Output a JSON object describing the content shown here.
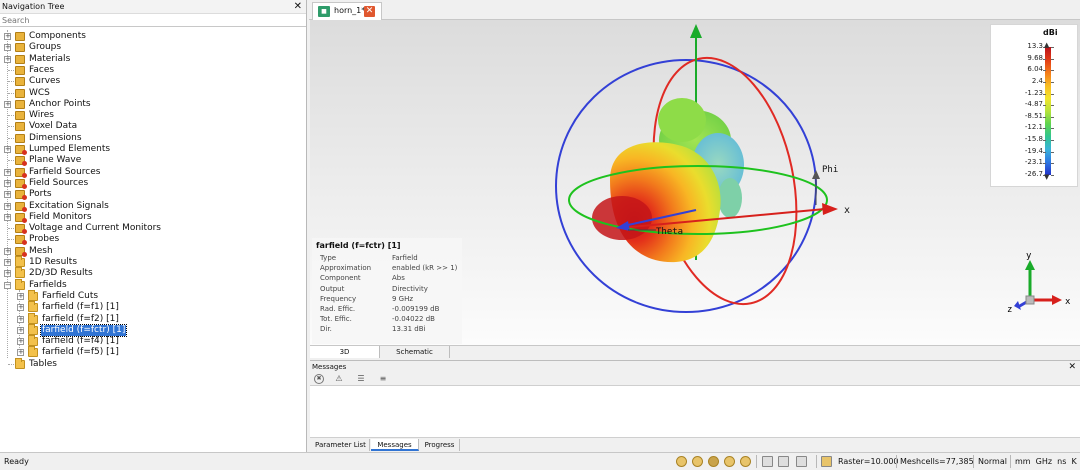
{
  "nav": {
    "title": "Navigation Tree",
    "close": "✕",
    "search_placeholder": "Search",
    "items": [
      {
        "label": "Components"
      },
      {
        "label": "Groups"
      },
      {
        "label": "Materials"
      },
      {
        "label": "Faces"
      },
      {
        "label": "Curves"
      },
      {
        "label": "WCS"
      },
      {
        "label": "Anchor Points"
      },
      {
        "label": "Wires"
      },
      {
        "label": "Voxel Data"
      },
      {
        "label": "Dimensions"
      },
      {
        "label": "Lumped Elements"
      },
      {
        "label": "Plane Wave"
      },
      {
        "label": "Farfield Sources"
      },
      {
        "label": "Field Sources"
      },
      {
        "label": "Ports"
      },
      {
        "label": "Excitation Signals"
      },
      {
        "label": "Field Monitors"
      },
      {
        "label": "Voltage and Current Monitors"
      },
      {
        "label": "Probes"
      },
      {
        "label": "Mesh"
      },
      {
        "label": "1D Results"
      },
      {
        "label": "2D/3D Results"
      },
      {
        "label": "Farfields"
      },
      {
        "label": "Farfield Cuts"
      },
      {
        "label": "farfield (f=f1) [1]"
      },
      {
        "label": "farfield (f=f2) [1]"
      },
      {
        "label": "farfield (f=fctr) [1]"
      },
      {
        "label": "farfield (f=f4) [1]"
      },
      {
        "label": "farfield (f=f5) [1]"
      },
      {
        "label": "Tables"
      }
    ]
  },
  "doc_tab": {
    "label": "horn_1*",
    "icon": "cst-doc-icon",
    "close": "✕"
  },
  "viewport": {
    "axis_labels": {
      "x": "x",
      "phi": "Phi",
      "theta": "Theta"
    },
    "triad_labels": {
      "x": "x",
      "y": "y",
      "z": "z"
    },
    "info": {
      "title": "farfield (f=fctr) [1]",
      "rows": [
        {
          "k": "Type",
          "v": "Farfield"
        },
        {
          "k": "Approximation",
          "v": "enabled (kR >> 1)"
        },
        {
          "k": "Component",
          "v": "Abs"
        },
        {
          "k": "Output",
          "v": "Directivity"
        },
        {
          "k": "Frequency",
          "v": "9 GHz"
        },
        {
          "k": "Rad. Effic.",
          "v": "-0.009199 dB"
        },
        {
          "k": "Tot. Effic.",
          "v": "-0.04022 dB"
        },
        {
          "k": "Dir.",
          "v": "13.31 dBi"
        }
      ]
    },
    "colorbar": {
      "unit": "dBi",
      "ticks": [
        "13.3",
        "9.68",
        "6.04",
        "2.4",
        "-1.23",
        "-4.87",
        "-8.51",
        "-12.1",
        "-15.8",
        "-19.4",
        "-23.1",
        "-26.7"
      ],
      "max_marker": "▲",
      "min_marker": "▼"
    },
    "colors": {
      "x_axis": "#d7201c",
      "y_axis": "#1aab2a",
      "theta_ring": "#e02a24",
      "phi_ring": "#3340d6",
      "eq_ring": "#1ec21e"
    }
  },
  "view_tabs": [
    "3D",
    "Schematic"
  ],
  "messages": {
    "title": "Messages",
    "close": "✕",
    "tools": [
      "✖",
      "⚠",
      "☰",
      "≡"
    ],
    "tabs": [
      "Parameter List",
      "Messages",
      "Progress"
    ]
  },
  "status": {
    "ready": "Ready",
    "raster": "Raster=10.000",
    "meshcells": "Meshcells=77,385",
    "mode": "Normal",
    "units": "mm  GHz  ns  K"
  }
}
